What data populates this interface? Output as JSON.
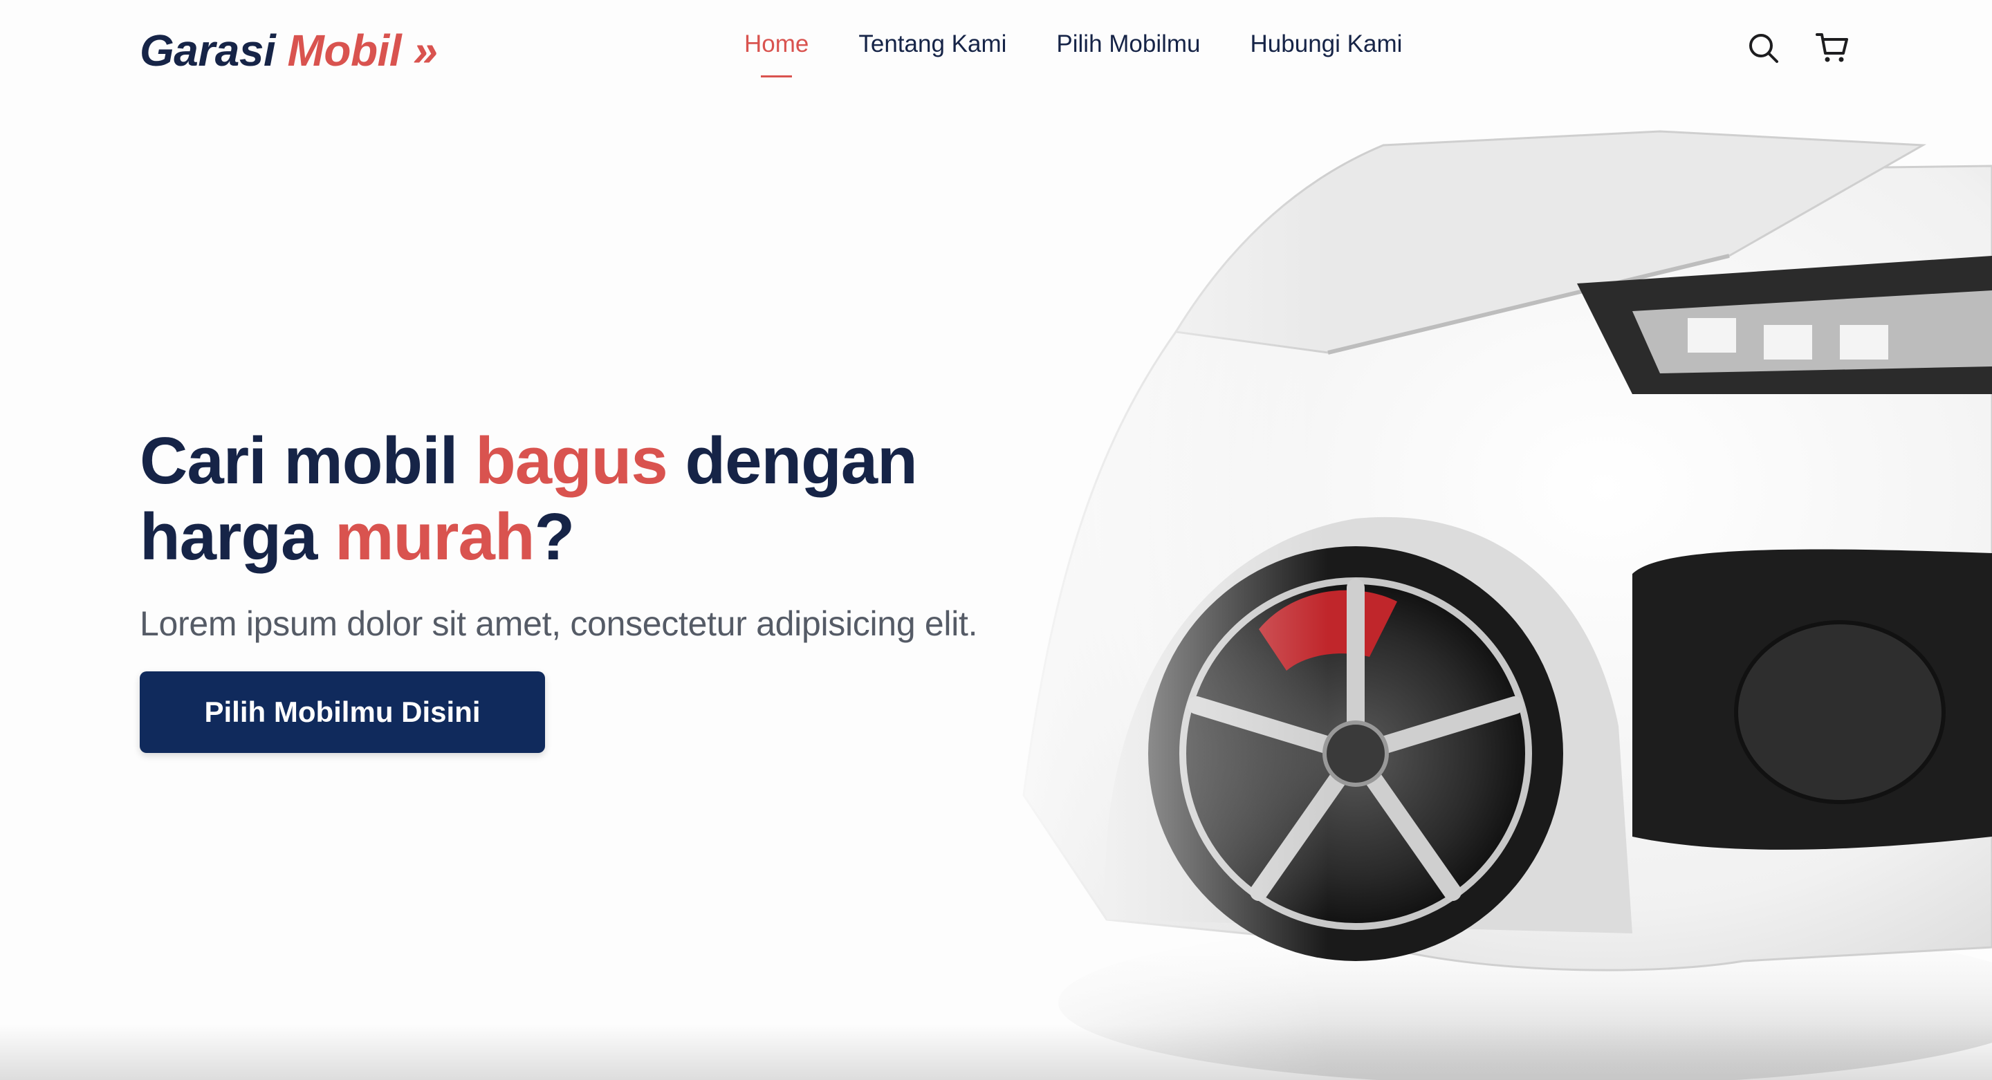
{
  "brand": {
    "name_part1": "Garasi",
    "name_part2": "Mobil »"
  },
  "nav": {
    "items": [
      {
        "label": "Home",
        "active": true
      },
      {
        "label": "Tentang Kami",
        "active": false
      },
      {
        "label": "Pilih Mobilmu",
        "active": false
      },
      {
        "label": "Hubungi Kami",
        "active": false
      }
    ],
    "icons": [
      "search-icon",
      "cart-icon"
    ]
  },
  "hero": {
    "title_part1": "Cari mobil ",
    "title_hl1": "bagus",
    "title_part2": " dengan",
    "title_part3": "harga ",
    "title_hl2": "murah",
    "title_part4": "?",
    "subtitle": "Lorem ipsum dolor sit amet, consectetur adipisicing elit.",
    "cta_label": "Pilih Mobilmu Disini"
  },
  "colors": {
    "primary": "#162447",
    "accent": "#d9534f",
    "button": "#102a5c"
  }
}
